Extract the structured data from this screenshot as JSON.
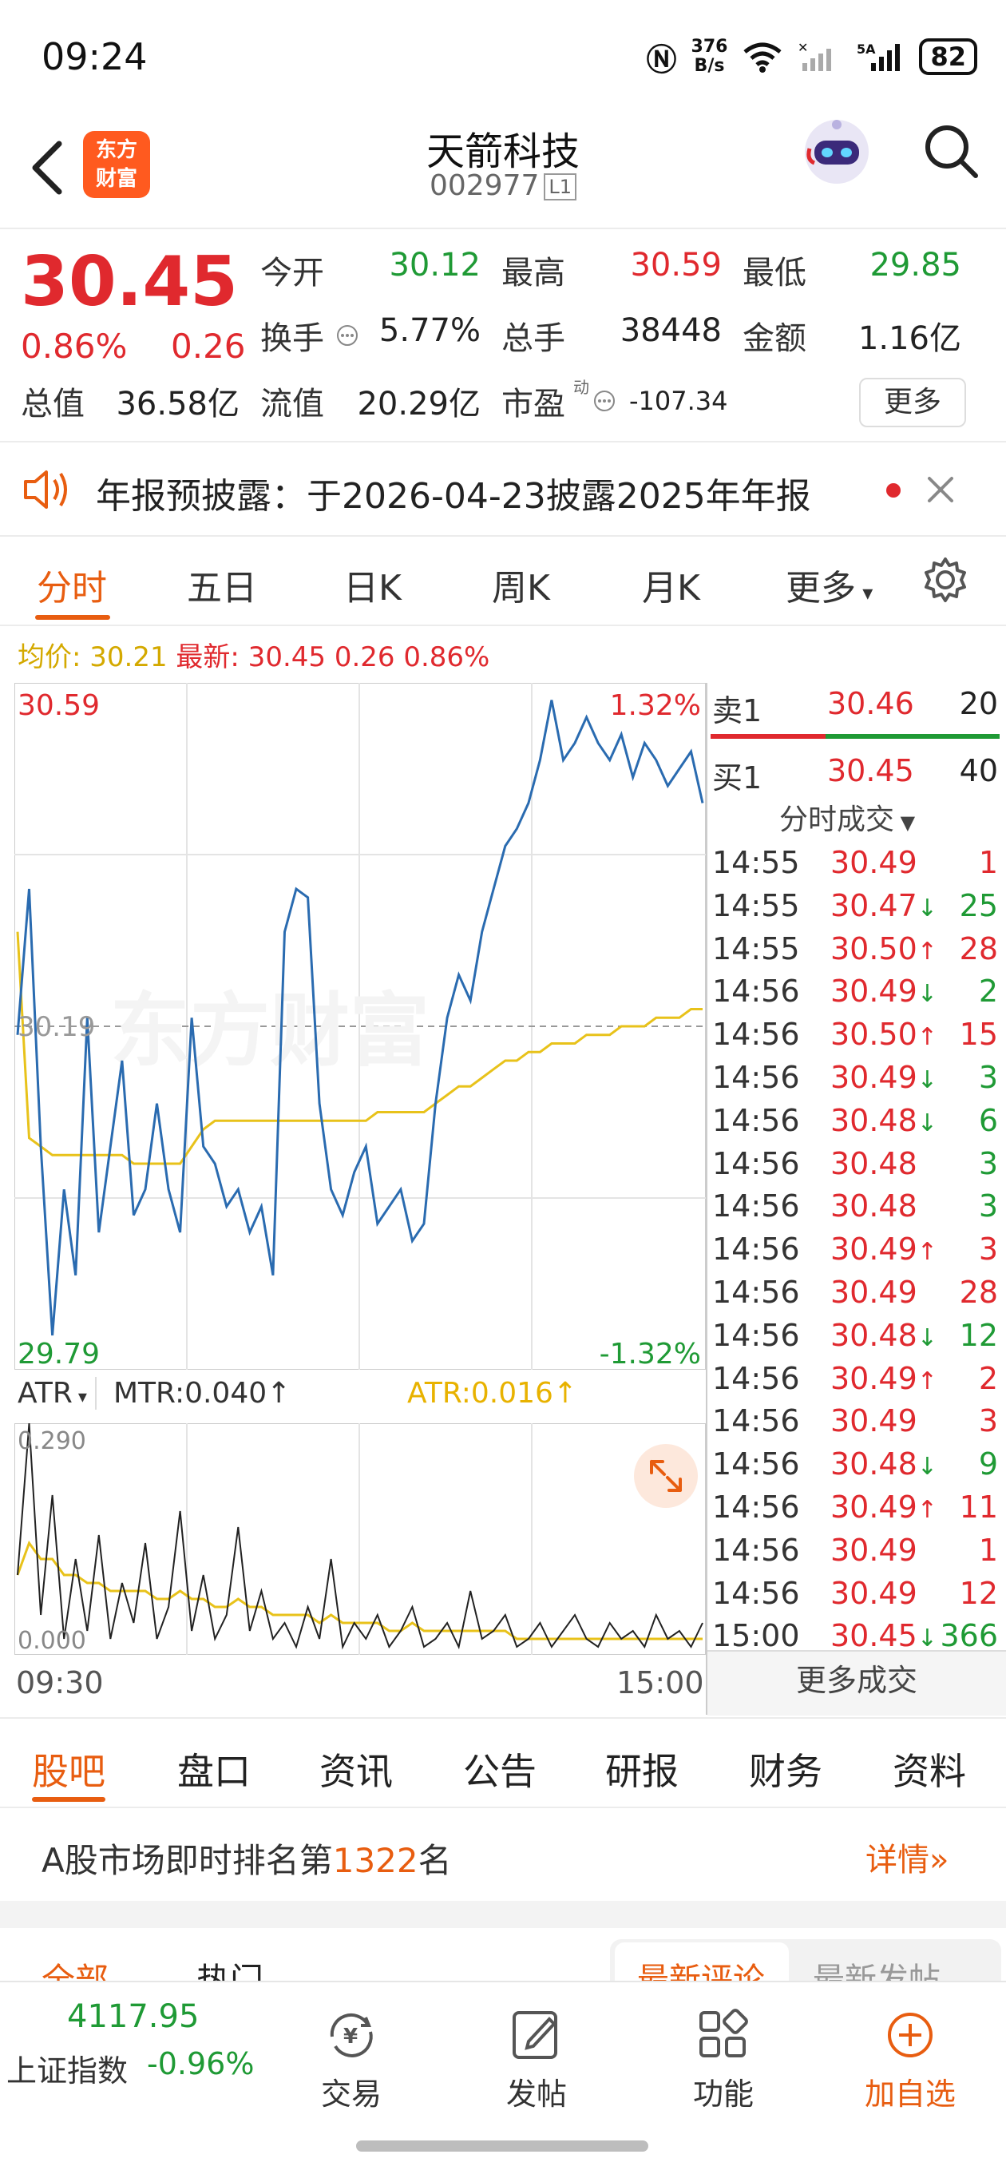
{
  "status_bar": {
    "time": "09:24",
    "net_speed_top": "376",
    "net_speed_bottom": "B/s",
    "battery": "82"
  },
  "header": {
    "stock_name": "天箭科技",
    "stock_code": "002977",
    "level": "L1",
    "logo_line1": "东方",
    "logo_line2": "财富"
  },
  "quote": {
    "price": "30.45",
    "change_pct": "0.86%",
    "change_amt": "0.26",
    "rows": [
      [
        {
          "label": "今开",
          "value": "30.12",
          "color": "green"
        },
        {
          "label": "最高",
          "value": "30.59",
          "color": "red"
        },
        {
          "label": "最低",
          "value": "29.85",
          "color": "green"
        }
      ],
      [
        {
          "label": "换手",
          "value": "5.77%",
          "color": "black"
        },
        {
          "label": "总手",
          "value": "38448",
          "color": "black"
        },
        {
          "label": "金额",
          "value": "1.16亿",
          "color": "black"
        }
      ],
      [
        {
          "label": "总值",
          "value": "36.58亿",
          "color": "black"
        },
        {
          "label": "流值",
          "value": "20.29亿",
          "color": "black"
        },
        {
          "label": "市盈",
          "value": "-107.34",
          "color": "black"
        }
      ]
    ],
    "pe_superscript": "动",
    "more_button": "更多"
  },
  "notice": {
    "text": "年报预披露：于2026-04-23披露2025年年报"
  },
  "tabs": [
    "分时",
    "五日",
    "日K",
    "周K",
    "月K",
    "更多"
  ],
  "chart_info": {
    "avg_label": "均价: 30.21",
    "latest_label": "最新: 30.45 0.26 0.86%"
  },
  "chart_data": [
    {
      "type": "line",
      "x_start_label": "09:30",
      "x_end_label": "15:00",
      "y_top_label": "30.59",
      "y_bottom_label": "29.79",
      "y_mid_label": "30.19",
      "pct_top_label": "1.32%",
      "pct_bottom_label": "-1.32%",
      "ylim": [
        29.79,
        30.59
      ],
      "series": [
        {
          "values": [
            30.18,
            30.35,
            30.05,
            29.83,
            30.0,
            29.9,
            30.2,
            29.95,
            30.05,
            30.15,
            29.97,
            30.0,
            30.1,
            30.0,
            29.95,
            30.2,
            30.05,
            30.03,
            29.98,
            30.0,
            29.95,
            29.98,
            29.9,
            30.3,
            30.35,
            30.34,
            30.1,
            30.0,
            29.97,
            30.02,
            30.05,
            29.96,
            29.98,
            30.0,
            29.94,
            29.96,
            30.1,
            30.2,
            30.25,
            30.22,
            30.3,
            30.35,
            30.4,
            30.42,
            30.45,
            30.5,
            30.57,
            30.5,
            30.52,
            30.55,
            30.52,
            30.5,
            30.53,
            30.48,
            30.52,
            30.5,
            30.47,
            30.49,
            30.51,
            30.45
          ]
        },
        {
          "values": [
            30.3,
            30.06,
            30.05,
            30.04,
            30.04,
            30.04,
            30.04,
            30.04,
            30.04,
            30.04,
            30.03,
            30.03,
            30.03,
            30.03,
            30.03,
            30.05,
            30.07,
            30.08,
            30.08,
            30.08,
            30.08,
            30.08,
            30.08,
            30.08,
            30.08,
            30.08,
            30.08,
            30.08,
            30.08,
            30.08,
            30.08,
            30.09,
            30.09,
            30.09,
            30.09,
            30.09,
            30.1,
            30.11,
            30.12,
            30.12,
            30.13,
            30.14,
            30.15,
            30.15,
            30.16,
            30.16,
            30.17,
            30.17,
            30.17,
            30.18,
            30.18,
            30.18,
            30.19,
            30.19,
            30.19,
            30.2,
            30.2,
            30.2,
            30.21,
            30.21
          ]
        }
      ]
    },
    {
      "type": "line",
      "indicator_label": "ATR",
      "mtr_label": "MTR:0.040",
      "atr_label": "ATR:0.016",
      "y_top_label": "0.290",
      "y_bottom_label": "0.000",
      "ylim": [
        0,
        0.29
      ],
      "series": [
        {
          "values": [
            0.1,
            0.29,
            0.05,
            0.2,
            0.02,
            0.12,
            0.03,
            0.15,
            0.02,
            0.09,
            0.04,
            0.14,
            0.02,
            0.06,
            0.18,
            0.03,
            0.1,
            0.02,
            0.05,
            0.16,
            0.03,
            0.08,
            0.02,
            0.04,
            0.01,
            0.06,
            0.02,
            0.12,
            0.01,
            0.04,
            0.02,
            0.05,
            0.01,
            0.03,
            0.06,
            0.01,
            0.02,
            0.04,
            0.01,
            0.08,
            0.02,
            0.03,
            0.05,
            0.01,
            0.02,
            0.04,
            0.01,
            0.03,
            0.05,
            0.02,
            0.01,
            0.04,
            0.02,
            0.03,
            0.01,
            0.05,
            0.02,
            0.03,
            0.01,
            0.04
          ]
        },
        {
          "values": [
            0.1,
            0.14,
            0.12,
            0.12,
            0.1,
            0.1,
            0.09,
            0.09,
            0.08,
            0.08,
            0.08,
            0.08,
            0.07,
            0.07,
            0.08,
            0.07,
            0.07,
            0.06,
            0.06,
            0.07,
            0.06,
            0.06,
            0.05,
            0.05,
            0.05,
            0.05,
            0.04,
            0.05,
            0.04,
            0.04,
            0.04,
            0.04,
            0.03,
            0.03,
            0.04,
            0.03,
            0.03,
            0.03,
            0.03,
            0.03,
            0.03,
            0.03,
            0.03,
            0.02,
            0.02,
            0.02,
            0.02,
            0.02,
            0.02,
            0.02,
            0.02,
            0.02,
            0.02,
            0.02,
            0.02,
            0.02,
            0.02,
            0.02,
            0.02,
            0.02
          ]
        }
      ]
    }
  ],
  "order_book": {
    "sell1_label": "卖1",
    "sell1_price": "30.46",
    "sell1_vol": "20",
    "buy1_label": "买1",
    "buy1_price": "30.45",
    "buy1_vol": "40"
  },
  "trades_header": "分时成交",
  "trades": [
    {
      "time": "14:55",
      "price": "30.49",
      "arrow": "",
      "vol": "1",
      "color": "red"
    },
    {
      "time": "14:55",
      "price": "30.47",
      "arrow": "↓",
      "vol": "25",
      "color": "green"
    },
    {
      "time": "14:55",
      "price": "30.50",
      "arrow": "↑",
      "vol": "28",
      "color": "red"
    },
    {
      "time": "14:56",
      "price": "30.49",
      "arrow": "↓",
      "vol": "2",
      "color": "green"
    },
    {
      "time": "14:56",
      "price": "30.50",
      "arrow": "↑",
      "vol": "15",
      "color": "red"
    },
    {
      "time": "14:56",
      "price": "30.49",
      "arrow": "↓",
      "vol": "3",
      "color": "green"
    },
    {
      "time": "14:56",
      "price": "30.48",
      "arrow": "↓",
      "vol": "6",
      "color": "green"
    },
    {
      "time": "14:56",
      "price": "30.48",
      "arrow": "",
      "vol": "3",
      "color": "green"
    },
    {
      "time": "14:56",
      "price": "30.48",
      "arrow": "",
      "vol": "3",
      "color": "green"
    },
    {
      "time": "14:56",
      "price": "30.49",
      "arrow": "↑",
      "vol": "3",
      "color": "red"
    },
    {
      "time": "14:56",
      "price": "30.49",
      "arrow": "",
      "vol": "28",
      "color": "red"
    },
    {
      "time": "14:56",
      "price": "30.48",
      "arrow": "↓",
      "vol": "12",
      "color": "green"
    },
    {
      "time": "14:56",
      "price": "30.49",
      "arrow": "↑",
      "vol": "2",
      "color": "red"
    },
    {
      "time": "14:56",
      "price": "30.49",
      "arrow": "",
      "vol": "3",
      "color": "red"
    },
    {
      "time": "14:56",
      "price": "30.48",
      "arrow": "↓",
      "vol": "9",
      "color": "green"
    },
    {
      "time": "14:56",
      "price": "30.49",
      "arrow": "↑",
      "vol": "11",
      "color": "red"
    },
    {
      "time": "14:56",
      "price": "30.49",
      "arrow": "",
      "vol": "1",
      "color": "red"
    },
    {
      "time": "14:56",
      "price": "30.49",
      "arrow": "",
      "vol": "12",
      "color": "red"
    },
    {
      "time": "15:00",
      "price": "30.45",
      "arrow": "↓",
      "vol": "366",
      "color": "green"
    }
  ],
  "more_trades": "更多成交",
  "sub_tabs": [
    "股吧",
    "盘口",
    "资讯",
    "公告",
    "研报",
    "财务",
    "资料"
  ],
  "rank": {
    "prefix": "A股市场即时排名第",
    "number": "1322",
    "suffix": "名",
    "detail": "详情"
  },
  "peek": {
    "left1": "全部",
    "left2": "热门",
    "right1": "最新评论",
    "right2": "最新发帖"
  },
  "bottom_bar": {
    "index_value": "4117.95",
    "index_name": "上证指数",
    "index_change": "-0.96%",
    "items": [
      "交易",
      "发帖",
      "功能",
      "加自选"
    ]
  },
  "colors": {
    "up": "#e0292e",
    "down": "#1f9a35",
    "accent": "#e85d10",
    "price_line": "#2a6bb0",
    "avg_line": "#e8c21a"
  }
}
